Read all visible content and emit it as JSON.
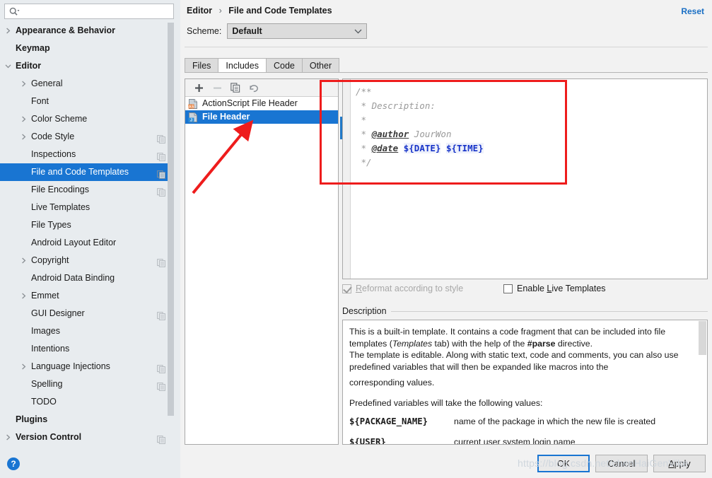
{
  "search": {
    "placeholder": "",
    "value": "",
    "icon": "search-icon"
  },
  "sidebar": {
    "items": [
      {
        "label": "Appearance & Behavior",
        "level": 0,
        "arrow": "chevron-right",
        "bold": true,
        "badge": false,
        "selected": false
      },
      {
        "label": "Keymap",
        "level": 0,
        "arrow": "none",
        "bold": true,
        "badge": false,
        "selected": false
      },
      {
        "label": "Editor",
        "level": 0,
        "arrow": "chevron-down",
        "bold": true,
        "badge": false,
        "selected": false
      },
      {
        "label": "General",
        "level": 1,
        "arrow": "chevron-right",
        "bold": false,
        "badge": false,
        "selected": false
      },
      {
        "label": "Font",
        "level": 1,
        "arrow": "none",
        "bold": false,
        "badge": false,
        "selected": false
      },
      {
        "label": "Color Scheme",
        "level": 1,
        "arrow": "chevron-right",
        "bold": false,
        "badge": false,
        "selected": false
      },
      {
        "label": "Code Style",
        "level": 1,
        "arrow": "chevron-right",
        "bold": false,
        "badge": true,
        "selected": false
      },
      {
        "label": "Inspections",
        "level": 1,
        "arrow": "none",
        "bold": false,
        "badge": true,
        "selected": false
      },
      {
        "label": "File and Code Templates",
        "level": 1,
        "arrow": "none",
        "bold": false,
        "badge": true,
        "selected": true
      },
      {
        "label": "File Encodings",
        "level": 1,
        "arrow": "none",
        "bold": false,
        "badge": true,
        "selected": false
      },
      {
        "label": "Live Templates",
        "level": 1,
        "arrow": "none",
        "bold": false,
        "badge": false,
        "selected": false
      },
      {
        "label": "File Types",
        "level": 1,
        "arrow": "none",
        "bold": false,
        "badge": false,
        "selected": false
      },
      {
        "label": "Android Layout Editor",
        "level": 1,
        "arrow": "none",
        "bold": false,
        "badge": false,
        "selected": false
      },
      {
        "label": "Copyright",
        "level": 1,
        "arrow": "chevron-right",
        "bold": false,
        "badge": true,
        "selected": false
      },
      {
        "label": "Android Data Binding",
        "level": 1,
        "arrow": "none",
        "bold": false,
        "badge": false,
        "selected": false
      },
      {
        "label": "Emmet",
        "level": 1,
        "arrow": "chevron-right",
        "bold": false,
        "badge": false,
        "selected": false
      },
      {
        "label": "GUI Designer",
        "level": 1,
        "arrow": "none",
        "bold": false,
        "badge": true,
        "selected": false
      },
      {
        "label": "Images",
        "level": 1,
        "arrow": "none",
        "bold": false,
        "badge": false,
        "selected": false
      },
      {
        "label": "Intentions",
        "level": 1,
        "arrow": "none",
        "bold": false,
        "badge": false,
        "selected": false
      },
      {
        "label": "Language Injections",
        "level": 1,
        "arrow": "chevron-right",
        "bold": false,
        "badge": true,
        "selected": false
      },
      {
        "label": "Spelling",
        "level": 1,
        "arrow": "none",
        "bold": false,
        "badge": true,
        "selected": false
      },
      {
        "label": "TODO",
        "level": 1,
        "arrow": "none",
        "bold": false,
        "badge": false,
        "selected": false
      },
      {
        "label": "Plugins",
        "level": 0,
        "arrow": "none",
        "bold": true,
        "badge": false,
        "selected": false
      },
      {
        "label": "Version Control",
        "level": 0,
        "arrow": "chevron-right",
        "bold": true,
        "badge": true,
        "selected": false
      }
    ]
  },
  "header": {
    "breadcrumb": [
      "Editor",
      "File and Code Templates"
    ],
    "breadcrumb_separator": "›",
    "reset_label": "Reset"
  },
  "scheme": {
    "label": "Scheme:",
    "value": "Default",
    "options": [
      "Default"
    ],
    "chevron": "chevron-down-icon"
  },
  "tabs": [
    {
      "label": "Files",
      "active": false
    },
    {
      "label": "Includes",
      "active": true
    },
    {
      "label": "Code",
      "active": false
    },
    {
      "label": "Other",
      "active": false
    }
  ],
  "list_toolbar": [
    {
      "name": "add-button",
      "glyph": "+",
      "enabled": true
    },
    {
      "name": "remove-button",
      "glyph": "−",
      "enabled": false
    },
    {
      "name": "copy-button",
      "glyph": "copy",
      "enabled": true
    },
    {
      "name": "revert-button",
      "glyph": "revert",
      "enabled": true
    }
  ],
  "template_list": [
    {
      "label": "ActionScript File Header",
      "icon_text": "AS",
      "icon_color": "#e8772e",
      "selected": false
    },
    {
      "label": "File Header",
      "icon_text": "J",
      "icon_color": "#2f8fd8",
      "selected": true
    }
  ],
  "editor": {
    "lines": [
      [
        {
          "t": "/**",
          "s": "comment"
        }
      ],
      [
        {
          "t": " * Description: ",
          "s": "comment"
        }
      ],
      [
        {
          "t": " *",
          "s": "comment"
        }
      ],
      [
        {
          "t": " * ",
          "s": "comment"
        },
        {
          "t": "@author",
          "s": "tag"
        },
        {
          "t": " JourWon",
          "s": "comment"
        }
      ],
      [
        {
          "t": " * ",
          "s": "comment"
        },
        {
          "t": "@date",
          "s": "tag"
        },
        {
          "t": " ",
          "s": "comment"
        },
        {
          "t": "${DATE}",
          "s": "var"
        },
        {
          "t": " ",
          "s": "comment"
        },
        {
          "t": "${TIME}",
          "s": "var"
        }
      ],
      [
        {
          "t": " */",
          "s": "comment"
        }
      ]
    ]
  },
  "options": {
    "reformat": {
      "label": "Reformat according to style",
      "mnemonic": "R",
      "checked": true,
      "enabled": false
    },
    "live_templates": {
      "label": "Enable Live Templates",
      "mnemonic": "L",
      "checked": false,
      "enabled": true
    }
  },
  "description": {
    "title": "Description",
    "paragraphs": [
      "This is a built-in template. It contains a code fragment that can be included into file templates (Templates tab) with the help of the #parse directive.",
      "The template is editable. Along with static text, code and comments, you can also use predefined variables that will then be expanded like macros into the corresponding values.",
      "Predefined variables will take the following values:"
    ],
    "variables": [
      {
        "name": "${PACKAGE_NAME}",
        "value": "name of the package in which the new file is created"
      },
      {
        "name": "${USER}",
        "value": "current user system login name"
      }
    ]
  },
  "buttons": {
    "ok": "OK",
    "cancel": "Cancel",
    "apply": "Apply",
    "help": "?"
  },
  "watermark": "https://blog.csdn.net/chenHaiGenVike",
  "colors": {
    "accent": "#1975d2",
    "link": "#1a6fc4",
    "annotation": "#ee1c1c",
    "sidebar_bg": "#e8ecef",
    "panel_bg": "#f2f2f2",
    "variable": "#1733c8"
  }
}
